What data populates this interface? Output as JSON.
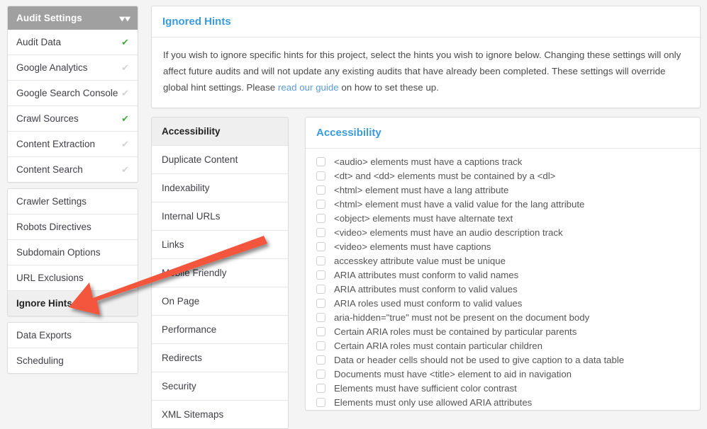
{
  "sidebar": {
    "header": {
      "title": "Audit Settings",
      "icon": "chevron-double-down-icon"
    },
    "groups": [
      {
        "items": [
          {
            "label": "Audit Data",
            "check": "✔",
            "checked": true
          },
          {
            "label": "Google Analytics",
            "check": "✔",
            "checked": false
          },
          {
            "label": "Google Search Console",
            "check": "✔",
            "checked": false
          },
          {
            "label": "Crawl Sources",
            "check": "✔",
            "checked": true
          },
          {
            "label": "Content Extraction",
            "check": "✔",
            "checked": false
          },
          {
            "label": "Content Search",
            "check": "✔",
            "checked": false
          }
        ]
      },
      {
        "items": [
          {
            "label": "Crawler Settings",
            "active": false
          },
          {
            "label": "Robots Directives",
            "active": false
          },
          {
            "label": "Subdomain Options",
            "active": false
          },
          {
            "label": "URL Exclusions",
            "active": false
          },
          {
            "label": "Ignore Hints",
            "active": true
          }
        ]
      },
      {
        "items": [
          {
            "label": "Data Exports",
            "active": false
          },
          {
            "label": "Scheduling",
            "active": false
          }
        ]
      }
    ]
  },
  "main": {
    "title": "Ignored Hints",
    "description_part1": "If you wish to ignore specific hints for this project, select the hints you wish to ignore below. Changing these settings will only affect future audits and will not update any existing audits that have already been completed. These settings will override global hint settings. Please ",
    "description_link": "read our guide",
    "description_part2": " on how to set these up."
  },
  "categories": [
    {
      "label": "Accessibility",
      "active": true
    },
    {
      "label": "Duplicate Content",
      "active": false
    },
    {
      "label": "Indexability",
      "active": false
    },
    {
      "label": "Internal URLs",
      "active": false
    },
    {
      "label": "Links",
      "active": false
    },
    {
      "label": "Mobile Friendly",
      "active": false
    },
    {
      "label": "On Page",
      "active": false
    },
    {
      "label": "Performance",
      "active": false
    },
    {
      "label": "Redirects",
      "active": false
    },
    {
      "label": "Security",
      "active": false
    },
    {
      "label": "XML Sitemaps",
      "active": false
    }
  ],
  "hints_panel": {
    "title": "Accessibility",
    "hints": [
      {
        "label": "<audio> elements must have a captions track",
        "checked": false
      },
      {
        "label": "<dt> and <dd> elements must be contained by a <dl>",
        "checked": false
      },
      {
        "label": "<html> element must have a lang attribute",
        "checked": false
      },
      {
        "label": "<html> element must have a valid value for the lang attribute",
        "checked": false
      },
      {
        "label": "<object> elements must have alternate text",
        "checked": false
      },
      {
        "label": "<video> elements must have an audio description track",
        "checked": false
      },
      {
        "label": "<video> elements must have captions",
        "checked": false
      },
      {
        "label": "accesskey attribute value must be unique",
        "checked": false
      },
      {
        "label": "ARIA attributes must conform to valid names",
        "checked": false
      },
      {
        "label": "ARIA attributes must conform to valid values",
        "checked": false
      },
      {
        "label": "ARIA roles used must conform to valid values",
        "checked": false
      },
      {
        "label": "aria-hidden=\"true\" must not be present on the document body",
        "checked": false
      },
      {
        "label": "Certain ARIA roles must be contained by particular parents",
        "checked": false
      },
      {
        "label": "Certain ARIA roles must contain particular children",
        "checked": false
      },
      {
        "label": "Data or header cells should not be used to give caption to a data table",
        "checked": false
      },
      {
        "label": "Documents must have <title> element to aid in navigation",
        "checked": false
      },
      {
        "label": "Elements must have sufficient color contrast",
        "checked": false
      },
      {
        "label": "Elements must only use allowed ARIA attributes",
        "checked": false
      }
    ]
  },
  "annotation": {
    "type": "arrow",
    "color": "#f4543c",
    "points_at": "Ignore Hints"
  },
  "colors": {
    "page_background": "#f4f4f4",
    "panel_background": "#ffffff",
    "sidebar_header": "#a0a0a0",
    "accent_blue": "#3a9bdc",
    "link_blue": "#5b9bd5",
    "check_green": "#49a942",
    "check_grey": "#d3d3d3",
    "active_row": "#efefef",
    "annotation_red": "#f4543c"
  }
}
